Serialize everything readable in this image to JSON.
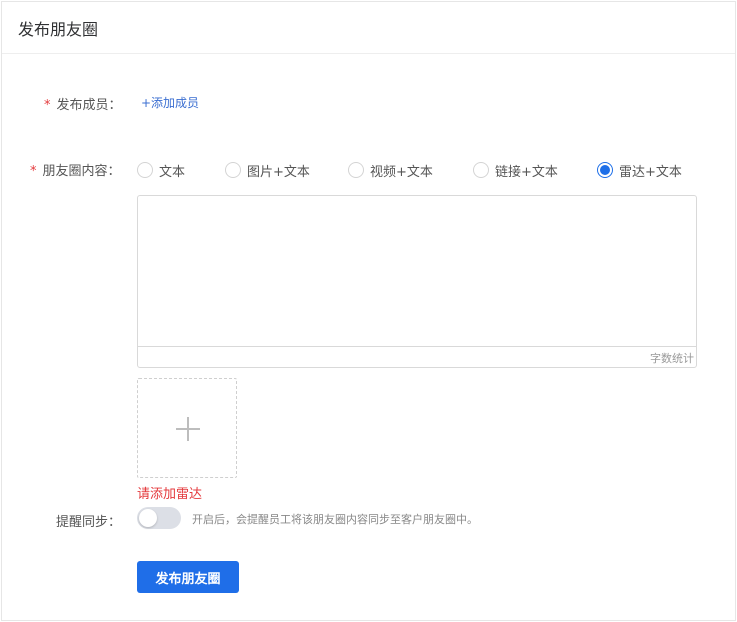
{
  "header": {
    "title": "发布朋友圈"
  },
  "form": {
    "member": {
      "required_mark": "*",
      "label": "发布成员：",
      "add_link": "+添加成员"
    },
    "content": {
      "required_mark": "*",
      "label": "朋友圈内容：",
      "options": [
        {
          "label": "文本",
          "checked": false
        },
        {
          "label": "图片+文本",
          "checked": false
        },
        {
          "label": "视频+文本",
          "checked": false
        },
        {
          "label": "链接+文本",
          "checked": false
        },
        {
          "label": "雷达+文本",
          "checked": true
        }
      ],
      "textarea_value": "",
      "char_count_label": "字数统计",
      "upload_icon": "plus-icon",
      "error_text": "请添加雷达"
    },
    "sync": {
      "label": "提醒同步：",
      "enabled": false,
      "description": "开启后，会提醒员工将该朋友圈内容同步至客户朋友圈中。"
    },
    "submit_label": "发布朋友圈"
  },
  "colors": {
    "accent": "#1f6ee8",
    "required": "#e4393c",
    "error": "#e4393c",
    "link": "#3a6ed1"
  }
}
